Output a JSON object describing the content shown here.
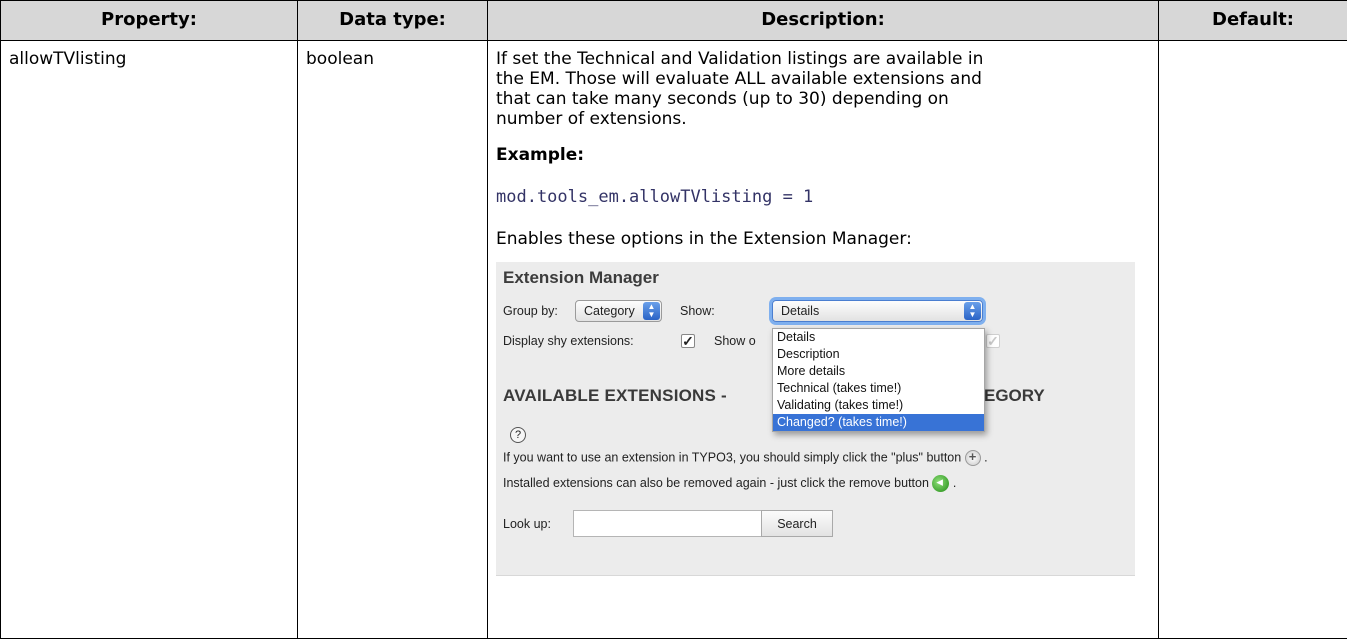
{
  "table": {
    "headers": [
      "Property:",
      "Data type:",
      "Description:",
      "Default:"
    ],
    "row": {
      "property": "allowTVlisting",
      "data_type": "boolean",
      "default": ""
    }
  },
  "description": {
    "para1_line1": "If set the Technical and Validation listings are available in",
    "para1_line2": "the EM. Those will evaluate ALL available extensions and",
    "para1_line3": "that can take many seconds (up to 30) depending on",
    "para1_line4": "number of extensions.",
    "example_heading": "Example:",
    "code": "mod.tools_em.allowTVlisting = 1",
    "enables_text": "Enables these options in the Extension Manager:"
  },
  "em": {
    "title": "Extension Manager",
    "group_by_label": "Group by:",
    "group_by_value": "Category",
    "show_label": "Show:",
    "show_value": "Details",
    "shy_label": "Display shy extensions:",
    "show_o_label": "Show o",
    "heading_left": "AVAILABLE EXTENSIONS -",
    "heading_right": "EGORY",
    "help_symbol": "?",
    "info_line1": "If you want to use an extension in TYPO3, you should simply click the \"plus\" button",
    "info_line2": "Installed extensions can also be removed again - just click the remove button",
    "period": ".",
    "lookup_label": "Look up:",
    "lookup_value": "",
    "search_label": "Search",
    "options": [
      "Details",
      "Description",
      "More details",
      "Technical (takes time!)",
      "Validating (takes time!)",
      "Changed? (takes time!)"
    ],
    "highlighted_option": "Changed? (takes time!)",
    "colors": {
      "highlight": "#3873d6",
      "panel_bg": "#ececec",
      "header_bg": "#d7d7d7",
      "code": "#333366"
    }
  }
}
